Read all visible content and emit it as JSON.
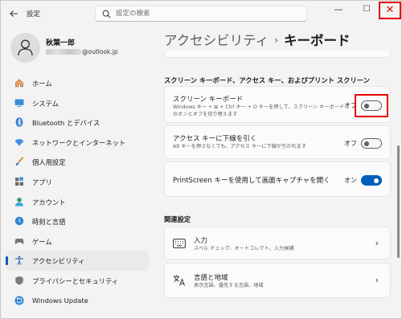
{
  "window": {
    "title": "設定",
    "back_icon": "back-arrow-icon",
    "minimize_label": "—",
    "maximize_label": "☐",
    "close_label": "✕"
  },
  "search": {
    "placeholder": "設定の検索",
    "value": ""
  },
  "profile": {
    "name": "秋葉一郎",
    "email_suffix": "@outlook.jp"
  },
  "sidebar": {
    "items": [
      {
        "label": "ホーム",
        "icon": "home-icon"
      },
      {
        "label": "システム",
        "icon": "system-icon"
      },
      {
        "label": "Bluetooth とデバイス",
        "icon": "bluetooth-icon"
      },
      {
        "label": "ネットワークとインターネット",
        "icon": "network-icon"
      },
      {
        "label": "個人用設定",
        "icon": "brush-icon"
      },
      {
        "label": "アプリ",
        "icon": "apps-icon"
      },
      {
        "label": "アカウント",
        "icon": "account-icon"
      },
      {
        "label": "時刻と言語",
        "icon": "time-language-icon"
      },
      {
        "label": "ゲーム",
        "icon": "game-icon"
      },
      {
        "label": "アクセシビリティ",
        "icon": "accessibility-icon",
        "active": true
      },
      {
        "label": "プライバシーとセキュリティ",
        "icon": "shield-icon"
      },
      {
        "label": "Windows Update",
        "icon": "update-icon"
      }
    ]
  },
  "breadcrumb": {
    "parent": "アクセシビリティ",
    "separator": "›",
    "current": "キーボード"
  },
  "section_keyboard": {
    "title": "スクリーン キーボード、アクセス キー、およびプリント スクリーン",
    "settings": [
      {
        "title": "スクリーン キーボード",
        "desc_line1": "Windows キー + ⊞ + Ctrl キー + O キーを押して、スクリーン キーボード",
        "desc_line2": "のオンとオフを切り替えます",
        "state_label": "オフ",
        "on": false
      },
      {
        "title": "アクセス キーに下線を引く",
        "desc_line1": "Alt キーを押さなくても、アクセス キーに下線が引かれます",
        "state_label": "オフ",
        "on": false
      },
      {
        "title": "PrintScreen キーを使用して画面キャプチャを開く",
        "state_label": "オン",
        "on": true
      }
    ]
  },
  "section_related": {
    "title": "関連設定",
    "links": [
      {
        "title": "入力",
        "desc": "スペル チェック、オートコレクト、入力候補",
        "icon": "keyboard-icon"
      },
      {
        "title": "言語と地域",
        "desc": "表示言語、優先する言語、地域",
        "icon": "language-icon"
      }
    ]
  },
  "colors": {
    "accent": "#005fb8",
    "highlight_red": "#e60000",
    "background": "#f3f3f3",
    "card": "#fbfbfb"
  }
}
